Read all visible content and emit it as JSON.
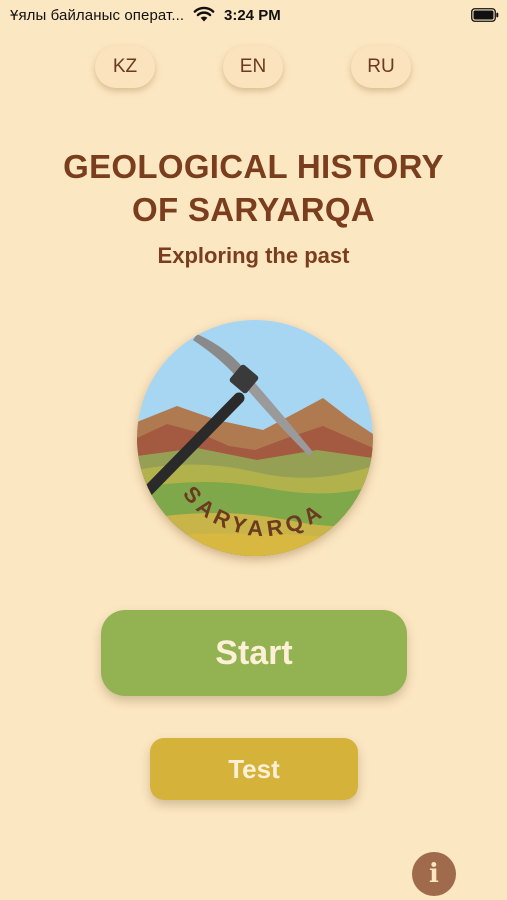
{
  "status_bar": {
    "carrier": "Ұялы байланыс операт...",
    "time": "3:24 PM",
    "wifi_icon": "wifi-icon",
    "battery_icon": "battery-icon"
  },
  "languages": [
    {
      "code": "KZ"
    },
    {
      "code": "EN"
    },
    {
      "code": "RU"
    }
  ],
  "header": {
    "title_line1": "GEOLOGICAL HISTORY",
    "title_line2": "OF SARYARQA",
    "subtitle": "Exploring the past"
  },
  "logo": {
    "text": "SARYARQA",
    "icon": "pickaxe-mountains-logo"
  },
  "actions": {
    "start_label": "Start",
    "test_label": "Test",
    "info_icon": "info-icon",
    "info_glyph": "i"
  },
  "colors": {
    "background": "#fce7c3",
    "title_brown": "#7a3e1e",
    "start_green": "#93b353",
    "test_gold": "#d5b33a",
    "info_brown": "#a06a4c"
  }
}
